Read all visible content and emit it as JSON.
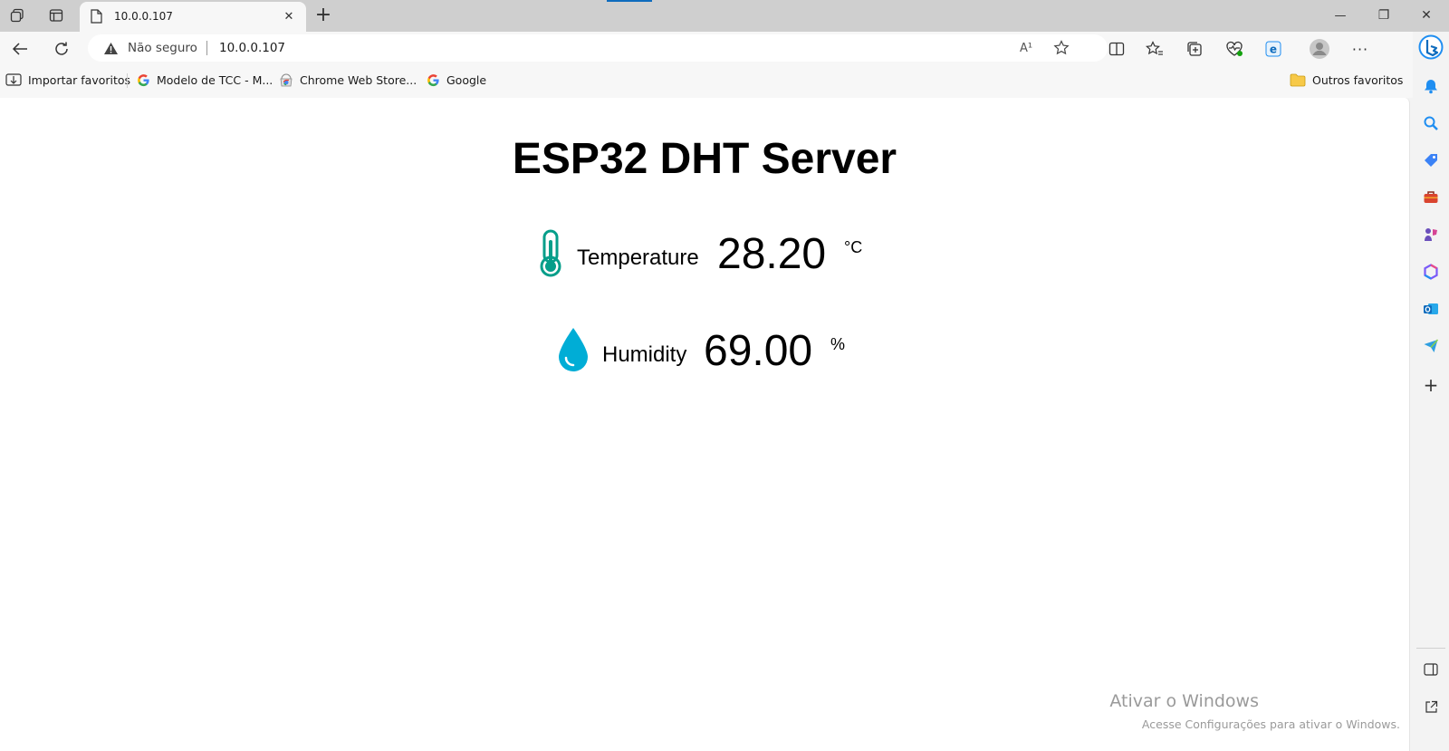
{
  "browser": {
    "tab": {
      "title": "10.0.0.107",
      "close_symbol": "✕"
    },
    "new_tab_symbol": "+",
    "window_controls": {
      "minimize": "—",
      "restore": "❐",
      "close": "✕"
    },
    "address": {
      "security_label": "Não seguro",
      "url": "10.0.0.107"
    },
    "favorites": [
      {
        "label": "Importar favoritos",
        "icon": "import-icon"
      },
      {
        "label": "Modelo de TCC - M...",
        "icon": "google-icon"
      },
      {
        "label": "Chrome Web Store...",
        "icon": "chrome-web-store-icon"
      },
      {
        "label": "Google",
        "icon": "google-icon"
      }
    ],
    "other_favorites": "Outros favoritos",
    "read_aloud_label": "A¹"
  },
  "page": {
    "title": "ESP32 DHT Server",
    "temperature": {
      "label": "Temperature",
      "value": "28.20",
      "unit": "°C",
      "icon_color": "#059e8a"
    },
    "humidity": {
      "label": "Humidity",
      "value": "69.00",
      "unit": "%",
      "icon_color": "#00add6"
    }
  },
  "watermark": {
    "line1": "Ativar o Windows",
    "line2": "Acesse Configurações para ativar o Windows."
  },
  "colors": {
    "edge_accent": "#0f6cbd",
    "copilot_blue": "#1f8ef1"
  }
}
